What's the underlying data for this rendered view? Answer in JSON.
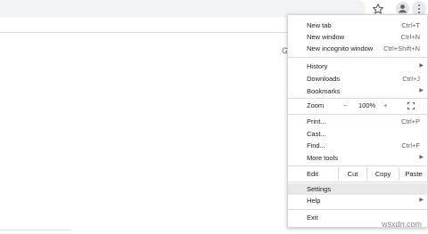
{
  "menu": {
    "section1": [
      {
        "label": "New tab",
        "shortcut": "Ctrl+T"
      },
      {
        "label": "New window",
        "shortcut": "Ctrl+N"
      },
      {
        "label": "New incognito window",
        "shortcut": "Ctrl+Shift+N"
      }
    ],
    "section2": [
      {
        "label": "History",
        "submenu": true
      },
      {
        "label": "Downloads",
        "shortcut": "Ctrl+J"
      },
      {
        "label": "Bookmarks",
        "submenu": true
      }
    ],
    "zoom": {
      "label": "Zoom",
      "minus": "−",
      "level": "100%",
      "plus": "+"
    },
    "section4": [
      {
        "label": "Print...",
        "shortcut": "Ctrl+P"
      },
      {
        "label": "Cast..."
      },
      {
        "label": "Find...",
        "shortcut": "Ctrl+F"
      },
      {
        "label": "More tools",
        "submenu": true
      }
    ],
    "edit": {
      "label": "Edit",
      "cut": "Cut",
      "copy": "Copy",
      "paste": "Paste"
    },
    "section6": [
      {
        "label": "Settings",
        "highlighted": true
      },
      {
        "label": "Help",
        "submenu": true
      }
    ],
    "exit": {
      "label": "Exit"
    },
    "submenu_arrow": "▶"
  },
  "toolbar": {
    "star_icon": "star-icon",
    "profile_icon": "profile-icon",
    "menu_icon": "three-dot-menu-icon"
  },
  "page": {
    "partial_letter": "G"
  },
  "watermark": "wsxdn.com",
  "colors": {
    "menu_highlight": "#e8e8e8",
    "omnibox": "#f1f3f4"
  }
}
